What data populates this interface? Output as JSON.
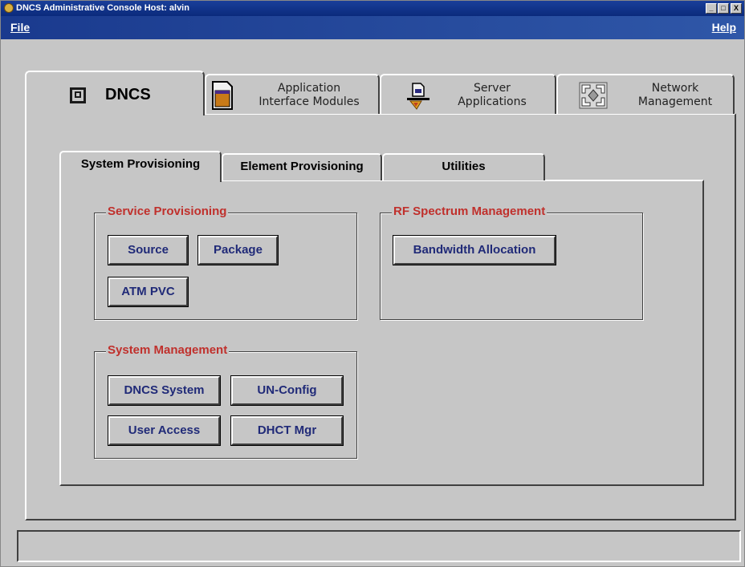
{
  "window": {
    "title": "DNCS Administrative Console  Host: alvin",
    "buttons": [
      "_",
      "□",
      "X"
    ]
  },
  "menubar": {
    "file": "File",
    "help": "Help"
  },
  "top_tabs": [
    {
      "label": "DNCS",
      "icon": "monitor-icon",
      "selected": true
    },
    {
      "label_line1": "Application",
      "label_line2": "Interface Modules",
      "icon": "document-icon"
    },
    {
      "label_line1": "Server",
      "label_line2": "Applications",
      "icon": "server-app-icon"
    },
    {
      "label_line1": "Network",
      "label_line2": "Management",
      "icon": "network-icon"
    }
  ],
  "inner_tabs": [
    {
      "label": "System Provisioning",
      "selected": true
    },
    {
      "label": "Element Provisioning"
    },
    {
      "label": "Utilities"
    }
  ],
  "groups": {
    "service": {
      "title": "Service Provisioning",
      "buttons": [
        "Source",
        "Package",
        "ATM PVC"
      ]
    },
    "rf": {
      "title": "RF Spectrum Management",
      "buttons": [
        "Bandwidth Allocation"
      ]
    },
    "system": {
      "title": "System Management",
      "buttons": [
        "DNCS System",
        "UN-Config",
        "User Access",
        "DHCT Mgr"
      ]
    }
  },
  "colors": {
    "legend": "#c0302c",
    "button_text": "#202a78",
    "titlebar": "#0b2a7c"
  }
}
